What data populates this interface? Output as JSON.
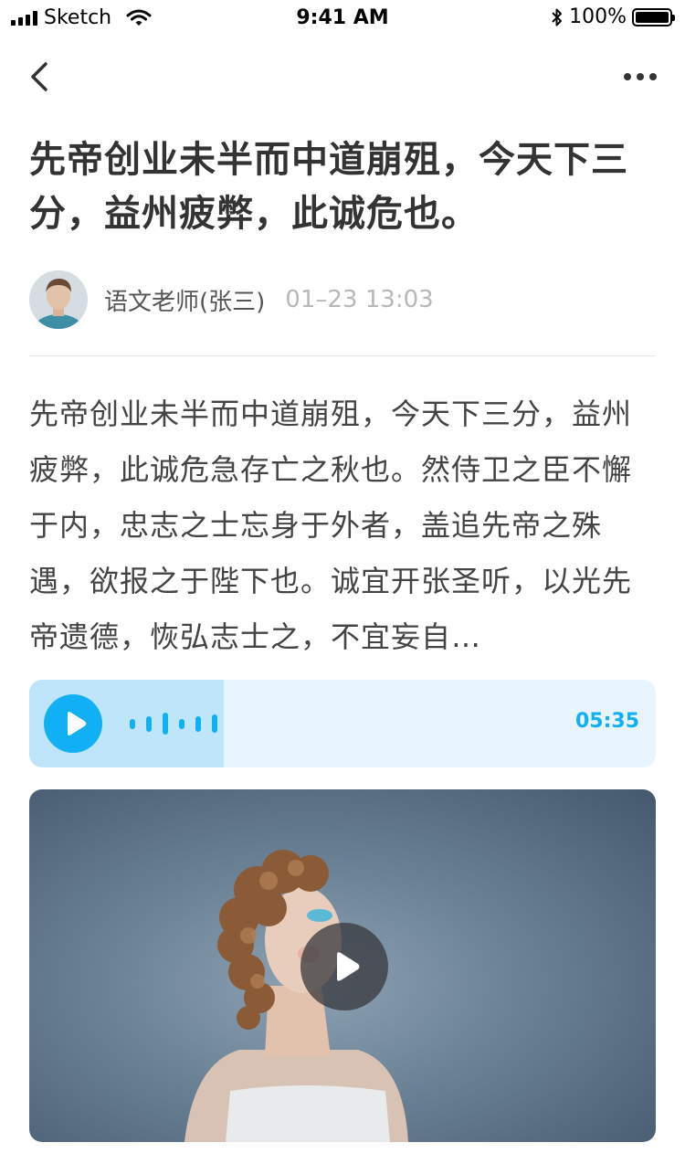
{
  "status_bar": {
    "carrier": "Sketch",
    "time": "9:41 AM",
    "battery": "100%"
  },
  "nav": {
    "back_icon": "chevron-left-icon",
    "more_icon": "more-horizontal-icon"
  },
  "article": {
    "title": "先帝创业未半而中道崩殂，今天下三分，益州疲弊，此诚危也。",
    "author": "语文老师(张三)",
    "time": "01–23 13:03",
    "body": "先帝创业未半而中道崩殂，今天下三分，益州疲弊，此诚危急存亡之秋也。然侍卫之臣不懈于内，忠志之士忘身于外者，盖追先帝之殊遇，欲报之于陛下也。诚宜开张圣听，以光先帝遗德，恢弘志士之，不宜妄自…"
  },
  "audio": {
    "duration": "05:35",
    "progress": 0.31,
    "accent": "#11b0f5"
  },
  "video": {
    "play_icon": "play-icon"
  }
}
